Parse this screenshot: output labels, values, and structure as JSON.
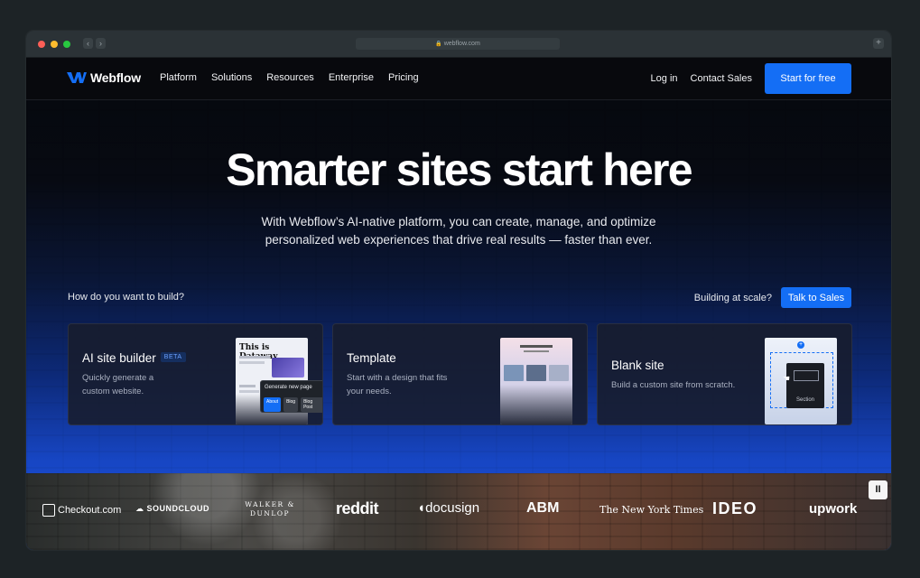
{
  "browser": {
    "url": "webflow.com"
  },
  "nav": {
    "brand": "Webflow",
    "links": [
      "Platform",
      "Solutions",
      "Resources",
      "Enterprise",
      "Pricing"
    ],
    "login": "Log in",
    "contact": "Contact Sales",
    "cta": "Start for free"
  },
  "hero": {
    "title": "Smarter sites start here",
    "subtitle_line1": "With Webflow’s AI-native platform, you can create, manage, and optimize",
    "subtitle_line2": "personalized web experiences that drive real results — faster than ever."
  },
  "build": {
    "question": "How do you want to build?",
    "scale_label": "Building at scale?",
    "scale_cta": "Talk to Sales"
  },
  "cards": [
    {
      "title": "AI site builder",
      "badge": "BETA",
      "desc_line1": "Quickly generate a",
      "desc_line2": "custom website.",
      "thumb": {
        "heading": "This is Dataway",
        "popup_title": "Generate new page",
        "chips": [
          "About",
          "Blog",
          "Blog Post"
        ]
      }
    },
    {
      "title": "Template",
      "desc_line1": "Start with a design that fits",
      "desc_line2": "your needs."
    },
    {
      "title": "Blank site",
      "desc_line1": "Build a custom site from scratch.",
      "thumb": {
        "section_label": "Section"
      }
    }
  ],
  "customers": [
    "Checkout.com",
    "SOUNDCLOUD",
    "WALKER & DUNLOP",
    "reddit",
    "docusign",
    "ABM",
    "The New York Times",
    "IDEO",
    "upwork"
  ],
  "colors": {
    "accent": "#146ef5",
    "background_top": "#06080d",
    "background_bottom": "#1b50d6"
  }
}
